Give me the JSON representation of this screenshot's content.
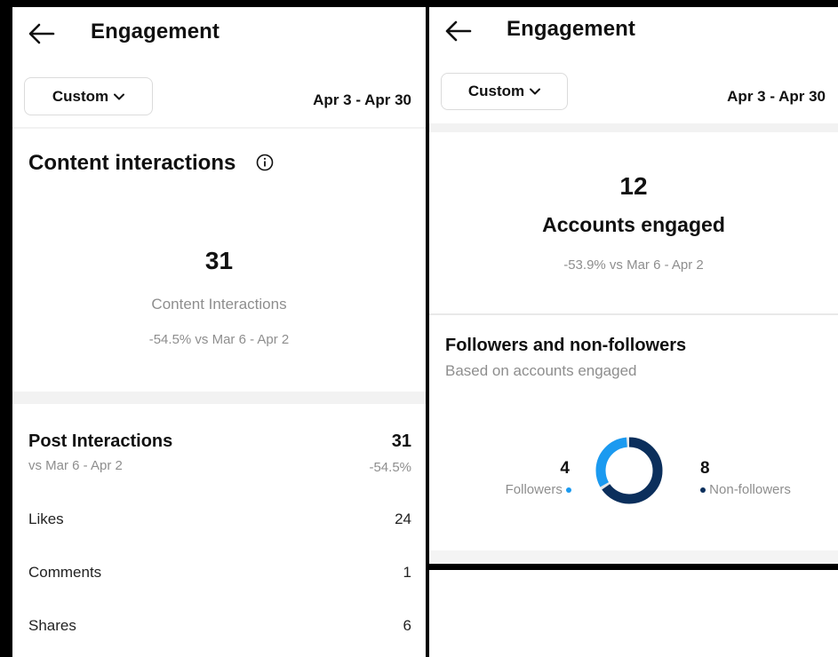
{
  "left": {
    "header": {
      "title": "Engagement"
    },
    "filter": {
      "custom_label": "Custom",
      "date_range": "Apr 3 - Apr 30"
    },
    "content_interactions": {
      "title": "Content interactions",
      "total": "31",
      "label": "Content Interactions",
      "comparison": "-54.5% vs Mar 6 - Apr 2"
    },
    "post_interactions": {
      "title": "Post Interactions",
      "total": "31",
      "subtitle": "vs Mar 6 - Apr 2",
      "change": "-54.5%",
      "rows": [
        {
          "label": "Likes",
          "value": "24"
        },
        {
          "label": "Comments",
          "value": "1"
        },
        {
          "label": "Shares",
          "value": "6"
        }
      ]
    }
  },
  "right": {
    "header": {
      "title": "Engagement"
    },
    "filter": {
      "custom_label": "Custom",
      "date_range": "Apr 3 - Apr 30"
    },
    "accounts_engaged": {
      "total": "12",
      "label": "Accounts engaged",
      "comparison": "-53.9% vs Mar 6 - Apr 2"
    },
    "followers_breakdown": {
      "title": "Followers and non-followers",
      "subtitle": "Based on accounts engaged",
      "followers_value": "4",
      "followers_label": "Followers",
      "non_followers_value": "8",
      "non_followers_label": "Non-followers",
      "followers_count": 4,
      "non_followers_count": 8,
      "followers_color": "#1b9af0",
      "non_followers_color": "#0b2f5c"
    }
  },
  "icons": {
    "back": "arrow-left-icon",
    "dropdown": "chevron-down-icon",
    "info": "info-circle-icon"
  }
}
